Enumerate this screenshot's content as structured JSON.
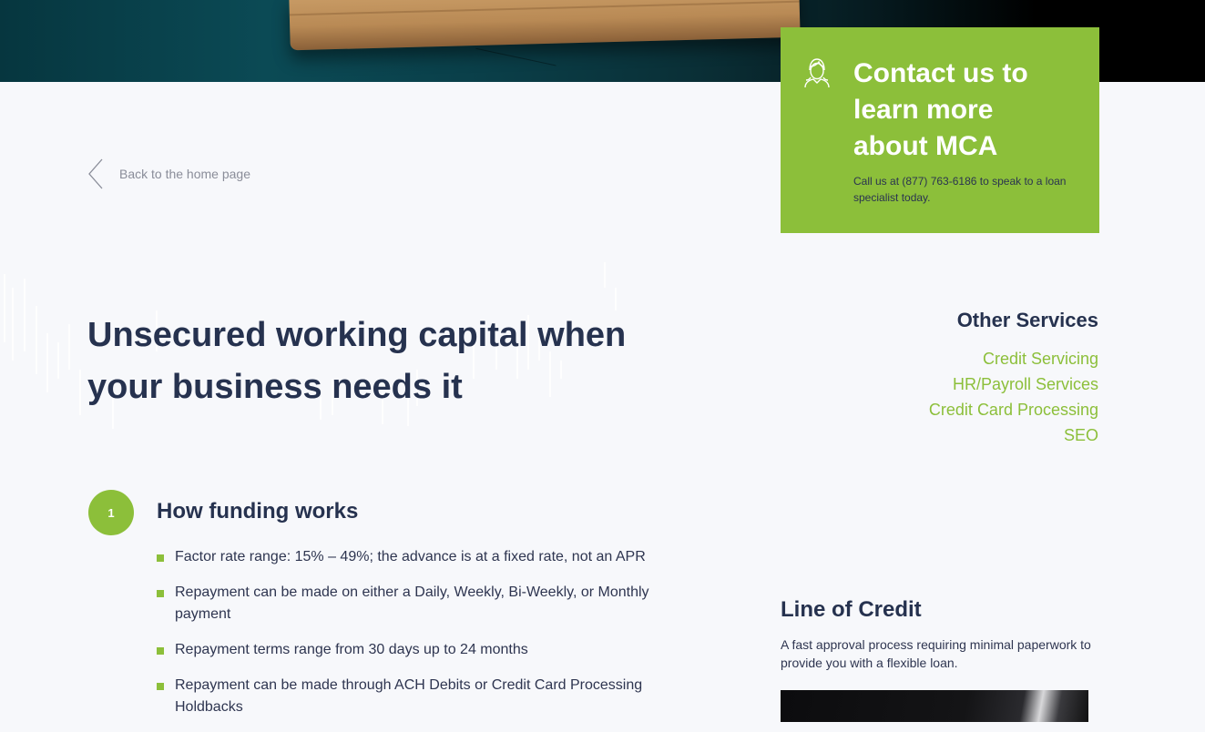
{
  "back_link": {
    "label": "Back to the home page",
    "icon": "chevron-left-icon"
  },
  "headline": {
    "line1": "Unsecured working capital when",
    "line2": "your business needs it"
  },
  "step": {
    "number": "1",
    "title": "How funding works",
    "items": [
      "Factor rate range: 15% – 49%; the advance is at a fixed rate, not an APR",
      "Repayment can be made on either a Daily, Weekly, Bi-Weekly, or Monthly payment",
      "Repayment terms range from 30 days up to 24 months",
      "Repayment can be made through ACH Debits or Credit Card Processing Holdbacks"
    ]
  },
  "contact": {
    "title": "Contact us to learn more about MCA",
    "text": "Call us at (877) 763-6186 to speak to a loan specialist today.",
    "icon": "support-agent-icon"
  },
  "other_services": {
    "title": "Other Services",
    "links": [
      "Credit Servicing",
      "HR/Payroll Services",
      "Credit Card Processing",
      "SEO"
    ]
  },
  "line_of_credit": {
    "title": "Line of Credit",
    "description": "A fast approval process requiring minimal paperwork to provide you with a flexible loan."
  },
  "colors": {
    "accent": "#8cbf3a",
    "heading": "#26324f",
    "background": "#f7f8fb"
  }
}
